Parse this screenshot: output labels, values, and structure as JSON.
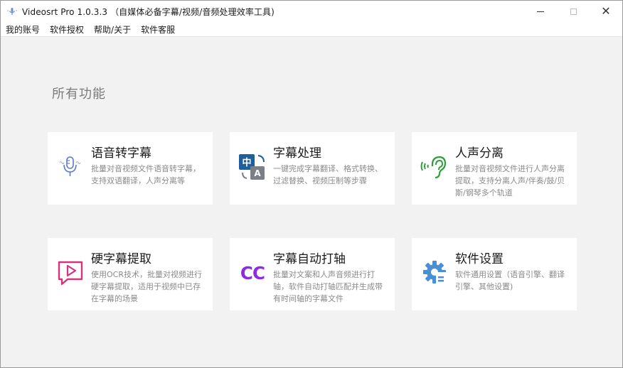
{
  "window": {
    "title": "Videosrt Pro 1.0.3.3 （自媒体必备字幕/视频/音频处理效率工具)",
    "close_glyph": "✕"
  },
  "menu": [
    "我的账号",
    "软件授权",
    "帮助/关于",
    "软件客服"
  ],
  "main": {
    "section_title": "所有功能",
    "cards": [
      {
        "title": "语音转字幕",
        "desc": "批量对音视频文件语音转字幕，支持双语翻译，人声分离等",
        "icon": "microphone-icon"
      },
      {
        "title": "字幕处理",
        "desc": "一键完成字幕翻译、格式转换、过滤替换、视频压制等步骤",
        "icon": "translate-icon",
        "icon_text_a": "中",
        "icon_text_b": "A"
      },
      {
        "title": "人声分离",
        "desc": "批量对音视频文件进行人声分离提取，支持分离人声/伴奏/鼓/贝斯/钢琴多个轨道",
        "icon": "ear-sound-icon"
      },
      {
        "title": "硬字幕提取",
        "desc": "使用OCR技术，批量对视频进行硬字幕提取，适用于视频中已存在字幕的场景",
        "icon": "play-bubble-icon"
      },
      {
        "title": "字幕自动打轴",
        "desc": "批量对文案和人声音频进行打轴，软件自动打轴匹配并生成带有时间轴的字幕文件",
        "icon": "cc-icon",
        "icon_text": "CC"
      },
      {
        "title": "软件设置",
        "desc": "软件通用设置（语音引擎、翻译引擎、其他设置)",
        "icon": "gear-icon"
      }
    ]
  },
  "colors": {
    "microphone": "#5a7ac8",
    "translate_dark": "#1f5f9e",
    "translate_gray": "#7b7f86",
    "ear": "#2e9e3a",
    "play_bubble": "#d6337f",
    "cc": "#8b2be2",
    "gear": "#4a8fd6"
  }
}
